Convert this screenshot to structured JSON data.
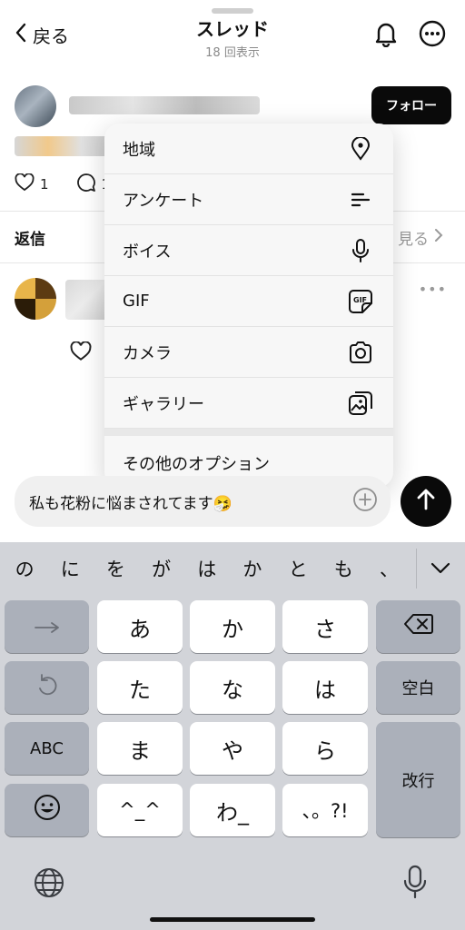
{
  "header": {
    "back_label": "戻る",
    "title": "スレッド",
    "subtitle": "18 回表示"
  },
  "post": {
    "follow_label": "フォロー",
    "like_count": "1",
    "comment_count": "1"
  },
  "replies": {
    "label": "返信",
    "see_more": "見る"
  },
  "attach_menu": {
    "items": [
      {
        "label": "地域",
        "icon": "location-pin-icon"
      },
      {
        "label": "アンケート",
        "icon": "poll-icon"
      },
      {
        "label": "ボイス",
        "icon": "microphone-icon"
      },
      {
        "label": "GIF",
        "icon": "gif-icon"
      },
      {
        "label": "カメラ",
        "icon": "camera-icon"
      },
      {
        "label": "ギャラリー",
        "icon": "gallery-icon"
      }
    ],
    "other_options": "その他のオプション"
  },
  "composer": {
    "value": "私も花粉に悩まされてます🤧"
  },
  "keyboard": {
    "candidates": [
      "の",
      "に",
      "を",
      "が",
      "は",
      "か",
      "と",
      "も",
      "、"
    ],
    "keys": {
      "a": "あ",
      "ka": "か",
      "sa": "さ",
      "ta": "た",
      "na": "な",
      "ha": "は",
      "ma": "ま",
      "ya": "や",
      "ra": "ら",
      "kaomoji": "^_^",
      "wa": "わ_",
      "punct": "、。?!",
      "space": "空白",
      "abc": "ABC",
      "enter": "改行"
    }
  },
  "colors": {
    "accent": "#0a0a0a",
    "keyboard_bg": "#d2d4d9",
    "key_dark": "#abb0ba"
  }
}
